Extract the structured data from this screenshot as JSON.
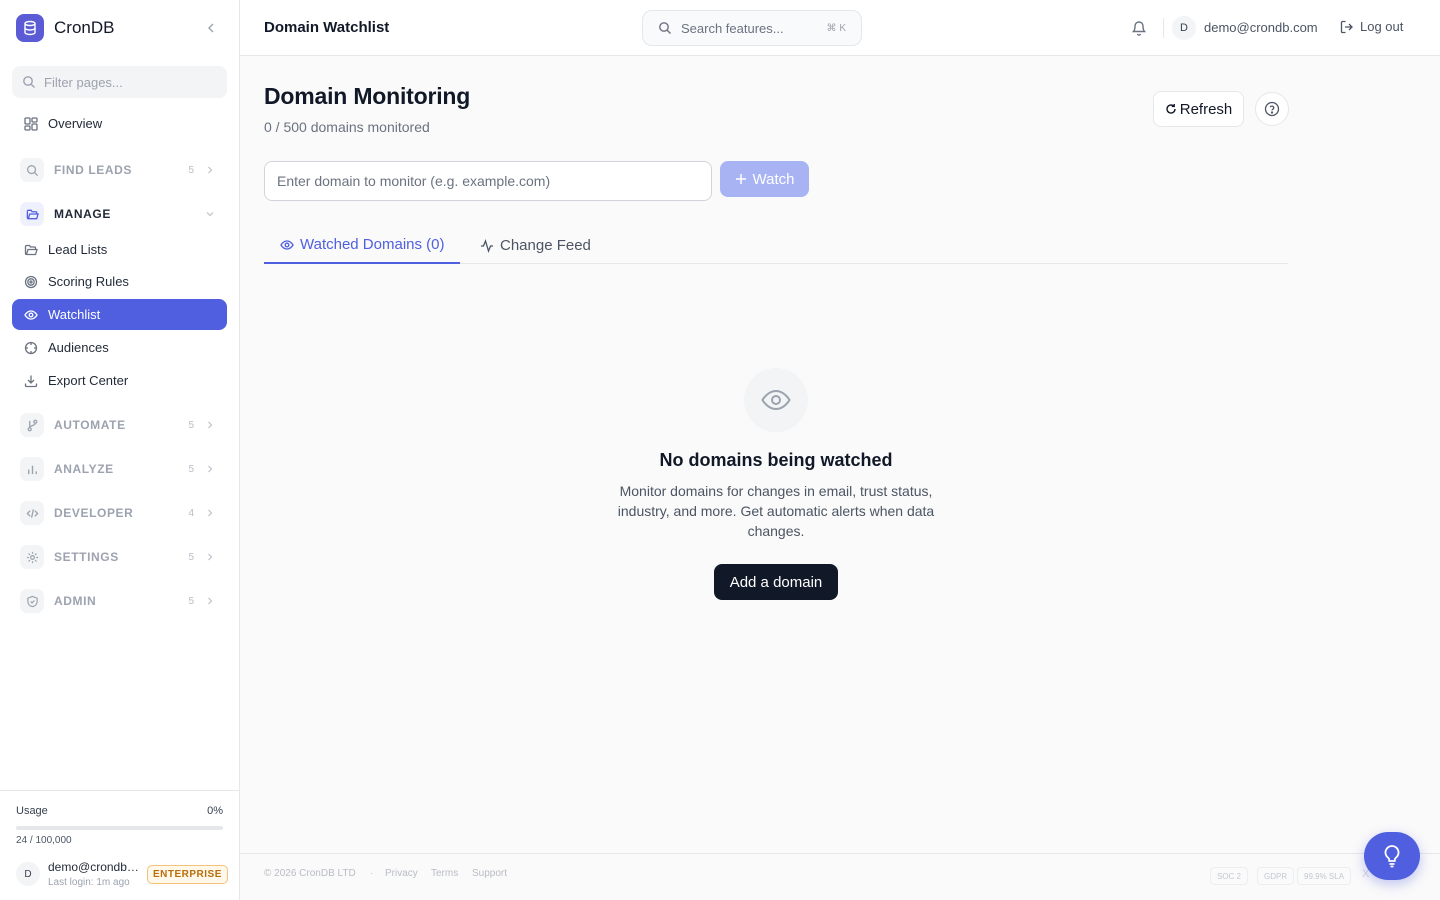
{
  "app": {
    "name": "CronDB"
  },
  "sidebar": {
    "filter_placeholder": "Filter pages...",
    "overview_label": "Overview",
    "groups": {
      "find_leads": {
        "label": "FIND LEADS",
        "count": "5"
      },
      "manage": {
        "label": "MANAGE"
      },
      "automate": {
        "label": "AUTOMATE",
        "count": "5"
      },
      "analyze": {
        "label": "ANALYZE",
        "count": "5"
      },
      "developer": {
        "label": "DEVELOPER",
        "count": "4"
      },
      "settings": {
        "label": "SETTINGS",
        "count": "5"
      },
      "admin": {
        "label": "ADMIN",
        "count": "5"
      }
    },
    "manage_items": [
      {
        "label": "Lead Lists",
        "icon": "folder-icon"
      },
      {
        "label": "Scoring Rules",
        "icon": "target-icon"
      },
      {
        "label": "Watchlist",
        "icon": "eye-icon",
        "active": true
      },
      {
        "label": "Audiences",
        "icon": "crosshair-icon"
      },
      {
        "label": "Export Center",
        "icon": "download-icon"
      }
    ],
    "usage": {
      "label": "Usage",
      "percent_text": "0%",
      "fraction": 0.00024,
      "count": "24 / 100,000"
    },
    "user": {
      "initial": "D",
      "email": "demo@crondb.com",
      "last_login": "Last login: 1m ago",
      "plan": "ENTERPRISE"
    }
  },
  "header": {
    "title": "Domain Watchlist",
    "search_placeholder": "Search features...",
    "search_shortcut": "⌘ K",
    "user_initial": "D",
    "user_email": "demo@crondb.com",
    "logout_label": "Log out"
  },
  "main": {
    "title": "Domain Monitoring",
    "subtitle": "0 / 500 domains monitored",
    "refresh_label": "Refresh",
    "input_placeholder": "Enter domain to monitor (e.g. example.com)",
    "watch_label": "Watch",
    "tabs": [
      {
        "label": "Watched Domains (0)",
        "active": true
      },
      {
        "label": "Change Feed",
        "active": false
      }
    ],
    "empty": {
      "title": "No domains being watched",
      "description": "Monitor domains for changes in email, trust status, industry, and more. Get automatic alerts when data changes.",
      "button_label": "Add a domain"
    }
  },
  "footer": {
    "copyright": "© 2026 CronDB LTD",
    "separator": "·",
    "links": [
      "Privacy",
      "Terms",
      "Support"
    ],
    "badges": [
      "SOC 2",
      "GDPR",
      "99.9% SLA"
    ],
    "x_label": "X"
  },
  "colors": {
    "accent": "#4f5fe0",
    "brand": "#5b5bd6",
    "dark_button": "#111827",
    "plan_badge": "#b86e0b"
  }
}
